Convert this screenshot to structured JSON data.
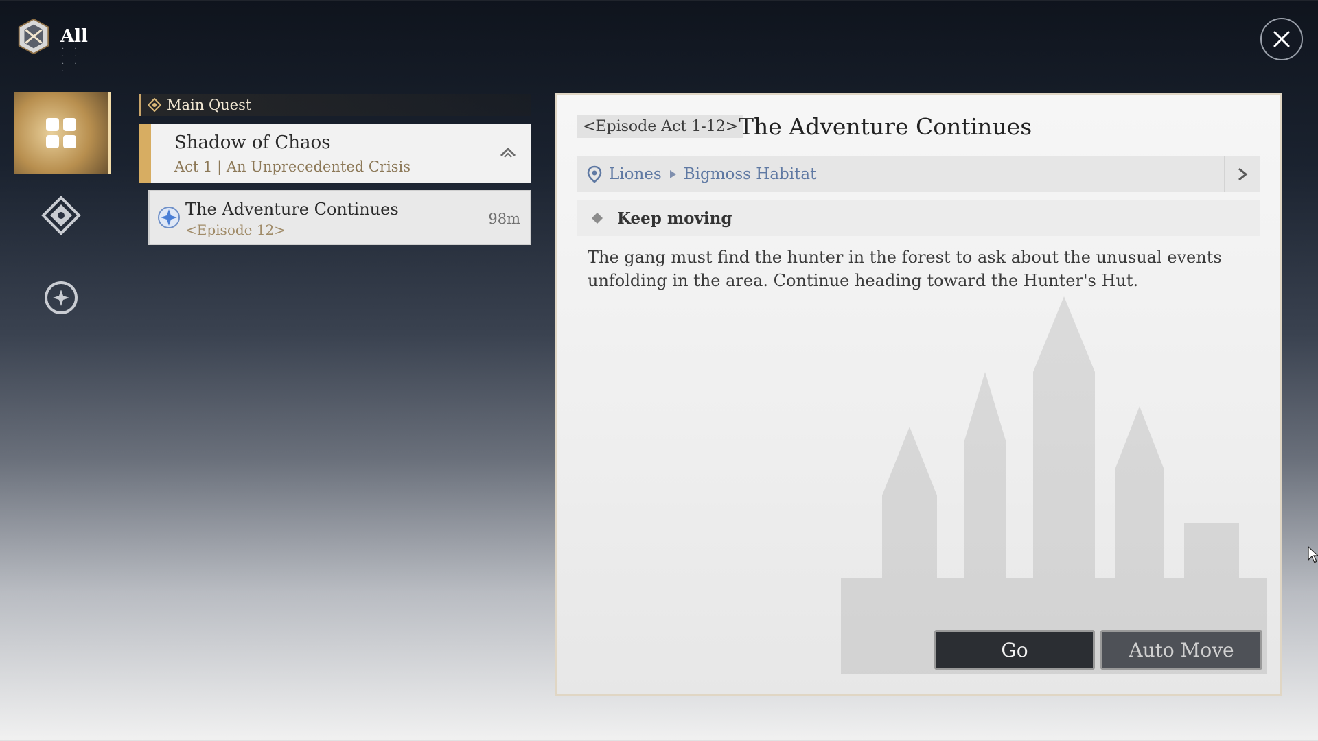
{
  "top_bar": {
    "filter_label": "All",
    "filter_sub": "· · · · · · ·",
    "close_icon": "close-icon"
  },
  "side_nav": {
    "items": [
      {
        "icon": "grid-icon",
        "active": true
      },
      {
        "icon": "compass-diamond-icon",
        "active": false
      },
      {
        "icon": "circle-star-icon",
        "active": false
      }
    ]
  },
  "quest_list": {
    "category_label": "Main Quest",
    "group": {
      "title": "Shadow of Chaos",
      "subtitle": "Act 1 | An Unprecedented Crisis"
    },
    "item": {
      "title": "The Adventure Continues",
      "episode": "<Episode 12>",
      "distance": "98m"
    }
  },
  "detail": {
    "episode_tag": "<Episode Act 1-12>",
    "title": "The Adventure Continues",
    "location": {
      "region": "Liones",
      "area": "Bigmoss Habitat"
    },
    "objective": "Keep moving",
    "description": "The gang must find the hunter in the forest to ask about the unusual events unfolding in the area. Continue heading toward the Hunter's Hut.",
    "buttons": {
      "go": "Go",
      "auto_move": "Auto Move"
    }
  },
  "colors": {
    "accent_gold": "#d7ad62",
    "link_blue": "#5f79a3",
    "button_dark": "#2b2e33"
  }
}
